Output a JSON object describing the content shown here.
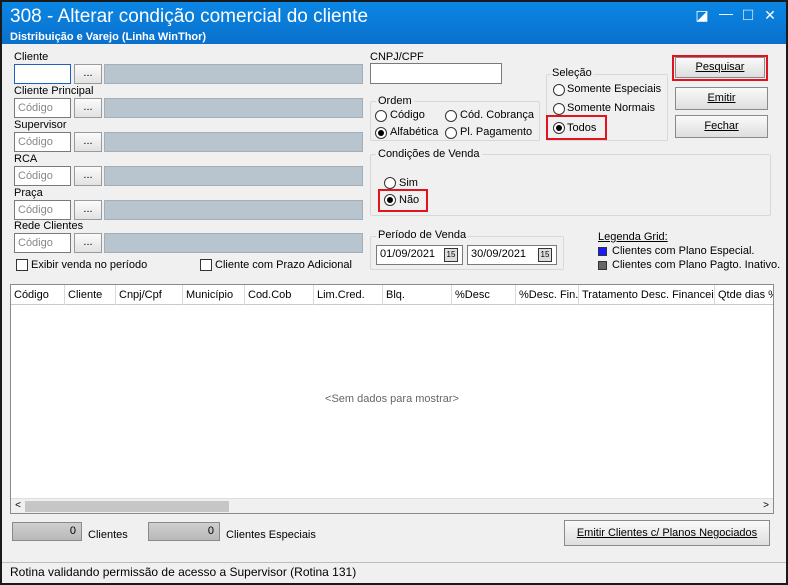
{
  "window": {
    "title": "308 - Alterar condição comercial do cliente",
    "subtitle": "Distribuição e Varejo (Linha WinThor)",
    "controls": {
      "restore": "◪",
      "minimize": "—",
      "maximize": "☐",
      "close": "✕"
    }
  },
  "filters": {
    "cliente": {
      "label": "Cliente",
      "value": "",
      "button": "..."
    },
    "cliente_principal": {
      "label": "Cliente Principal",
      "placeholder": "Código",
      "button": "..."
    },
    "supervisor": {
      "label": "Supervisor",
      "placeholder": "Código",
      "button": "..."
    },
    "rca": {
      "label": "RCA",
      "placeholder": "Código",
      "button": "..."
    },
    "praca": {
      "label": "Praça",
      "placeholder": "Código",
      "button": "..."
    },
    "rede_clientes": {
      "label": "Rede Clientes",
      "placeholder": "Código",
      "button": "..."
    },
    "exibir_venda": {
      "label": "Exibir venda no período",
      "checked": false
    },
    "prazo_adicional": {
      "label": "Cliente com Prazo Adicional",
      "checked": false
    }
  },
  "cnpj": {
    "label": "CNPJ/CPF",
    "value": ""
  },
  "ordem": {
    "title": "Ordem",
    "options": [
      "Código",
      "Cód. Cobrança",
      "Alfabética",
      "Pl. Pagamento"
    ],
    "selected": "Alfabética"
  },
  "selecao": {
    "title": "Seleção",
    "options": [
      "Somente Especiais",
      "Somente Normais",
      "Todos"
    ],
    "selected": "Todos"
  },
  "condicoes": {
    "title": "Condições de Venda",
    "options": [
      "Sim",
      "Não"
    ],
    "selected": "Não"
  },
  "periodo": {
    "title": "Período de Venda",
    "start": "01/09/2021",
    "end": "30/09/2021",
    "cal_icon": "15"
  },
  "buttons": {
    "pesquisar": "Pesquisar",
    "emitir": "Emitir",
    "fechar": "Fechar",
    "emitir_planos": "Emitir Clientes c/ Planos Negociados"
  },
  "legend": {
    "title": "Legenda Grid:",
    "items": [
      {
        "label": "Clientes com Plano Especial.",
        "color": "#1a1aff"
      },
      {
        "label": "Clientes com Plano Pagto. Inativo.",
        "color": "#666666"
      }
    ]
  },
  "grid": {
    "columns": [
      "Código",
      "Cliente",
      "Cnpj/Cpf",
      "Município",
      "Cod.Cob",
      "Lim.Cred.",
      "Blq.",
      "%Desc",
      "%Desc. Fin.",
      "Tratamento Desc. Financeir",
      "Qtde dias %"
    ],
    "empty_text": "<Sem dados para mostrar>",
    "scroll_left": "<",
    "scroll_right": ">"
  },
  "totals": {
    "clientes": {
      "value": "0",
      "label": "Clientes"
    },
    "especiais": {
      "value": "0",
      "label": "Clientes Especiais"
    }
  },
  "status": "Rotina validando permissão de acesso a Supervisor (Rotina 131)"
}
